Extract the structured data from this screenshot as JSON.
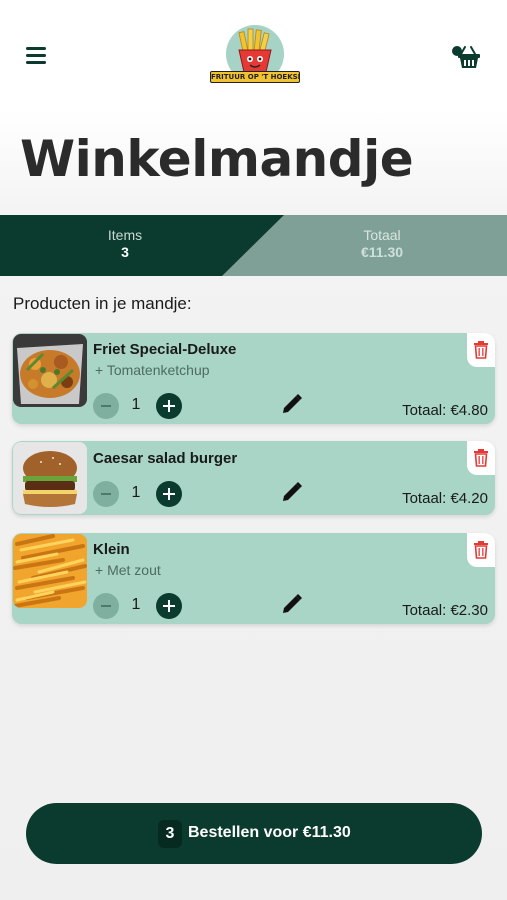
{
  "header": {
    "menu_icon": "hamburger-menu-icon",
    "logo_text": "FRITUUR OP 'T HOEKSKE",
    "cart_icon": "basket-icon"
  },
  "page": {
    "title": "Winkelmandje"
  },
  "summary": {
    "items_label": "Items",
    "items_value": "3",
    "total_label": "Totaal",
    "total_value": "€11.30"
  },
  "cart": {
    "section_label": "Producten in je mandje:",
    "items": [
      {
        "name": "Friet Special-Deluxe",
        "extra": "+ Tomatenketchup",
        "quantity": "1",
        "total": "Totaal: €4.80"
      },
      {
        "name": "Caesar salad burger",
        "extra": "",
        "quantity": "1",
        "total": "Totaal: €4.20"
      },
      {
        "name": "Klein",
        "extra": "+ Met zout",
        "quantity": "1",
        "total": "Totaal: €2.30"
      }
    ]
  },
  "order": {
    "count": "3",
    "label": "Bestellen voor €11.30"
  },
  "colors": {
    "primary": "#0b3b2e",
    "card": "#a8d5c5",
    "summary_right": "#7fa096",
    "delete": "#e53935"
  }
}
